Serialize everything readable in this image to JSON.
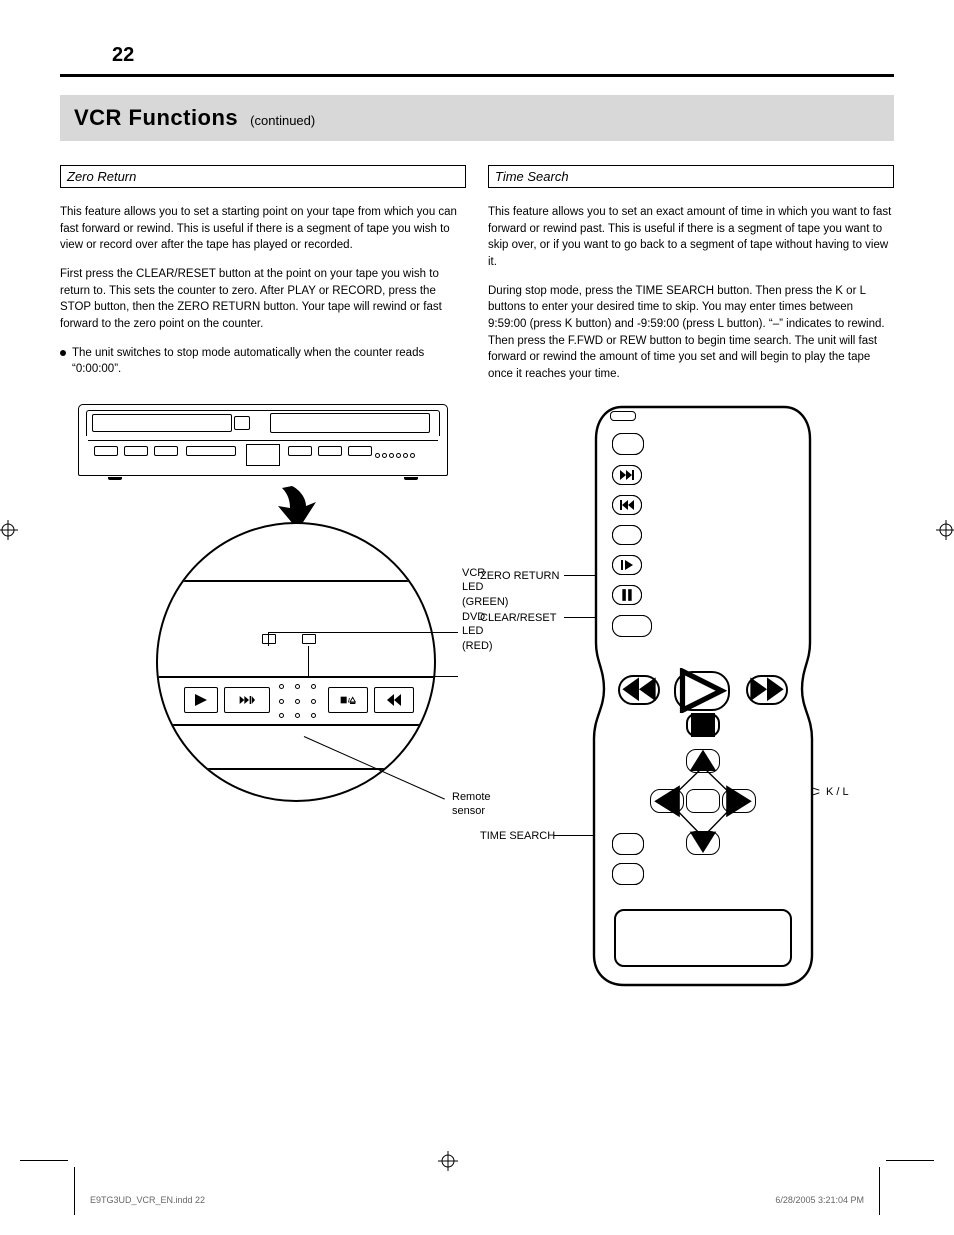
{
  "page_number": "22",
  "header": {
    "title": "VCR Functions",
    "subtitle": "(continued)"
  },
  "left": {
    "subhead": "Zero Return",
    "p1": "This feature allows you to set a starting point on your tape from which you can fast forward or rewind. This is useful if there is a segment of tape you wish to view or record over after the tape has played or recorded.",
    "p2": "First press the CLEAR/RESET button at the point on your tape you wish to return to. This sets the counter to zero. After PLAY or RECORD, press the STOP button, then the ZERO RETURN button. Your tape will rewind or fast forward to the zero point on the counter.",
    "bullet": "The unit switches to stop mode automatically when the counter reads “0:00:00”.",
    "labels": {
      "vcr": "VCR LED (GREEN)",
      "dvd": "DVD LED (RED)",
      "sensor": "Remote sensor"
    }
  },
  "right": {
    "subhead": "Time Search",
    "p1": "This feature allows you to set an exact amount of time in which you want to fast forward or rewind past. This is useful if there is a segment of tape you want to skip over, or if you want to go back to a segment of tape without having to view it.",
    "p2_a": "During stop mode, press the TIME SEARCH button. Then press the ",
    "p2_up": "K",
    "p2_mid": " or ",
    "p2_dn": "L",
    "p2_b": " buttons to enter your desired time to skip. You may enter times between 9:59:00 (press ",
    "p2_c": " button) and -9:59:00 (press ",
    "p2_d": " button). “–” indicates to rewind. Then press the F.FWD or REW button to begin time search. The unit will fast forward or rewind the amount of time you set and will begin to play the tape once it reaches your time.",
    "labels": {
      "zero": "ZERO RETURN",
      "clear": "CLEAR/RESET",
      "time": "TIME SEARCH",
      "updn": "K / L"
    }
  },
  "footer_tag": "E9TG3UD_VCR_EN.indd   22",
  "footer_time": "6/28/2005   3:21:04 PM",
  "icons": {
    "play": "play-icon",
    "ff": "ff-icon",
    "rew": "rew-icon",
    "stop": "stop-icon",
    "eject": "eject-icon",
    "pause": "pause-icon",
    "up": "up-icon",
    "down": "down-icon",
    "left": "left-icon",
    "right": "right-icon"
  }
}
